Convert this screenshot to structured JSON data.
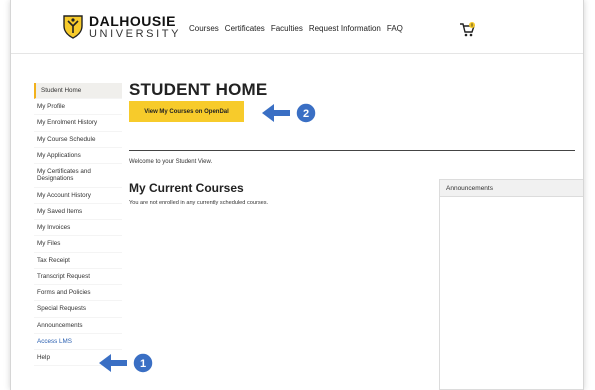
{
  "header": {
    "logo_line1": "DALHOUSIE",
    "logo_line2": "UNIVERSITY",
    "nav": [
      "Courses",
      "Certificates",
      "Faculties",
      "Request Information",
      "FAQ"
    ],
    "cart_count": "0"
  },
  "sidebar": {
    "items": [
      "Student Home",
      "My Profile",
      "My Enrolment History",
      "My Course Schedule",
      "My Applications",
      "My Certificates and Designations",
      "My Account History",
      "My Saved Items",
      "My Invoices",
      "My Files",
      "Tax Receipt",
      "Transcript Request",
      "Forms and Policies",
      "Special Requests",
      "Announcements",
      "Access LMS",
      "Help"
    ]
  },
  "main": {
    "title": "STUDENT HOME",
    "opendal_button": "View My Courses on OpenDal",
    "welcome": "Welcome to your Student View.",
    "current_courses_heading": "My Current Courses",
    "no_courses_text": "You are not enrolled in any currently scheduled courses."
  },
  "announcements": {
    "heading": "Announcements"
  },
  "annotations": {
    "marker1": "1",
    "marker2": "2"
  },
  "colors": {
    "accent_yellow": "#f7cb2b",
    "annotation_blue": "#3a6fc4",
    "link_blue": "#2a5fb0"
  }
}
